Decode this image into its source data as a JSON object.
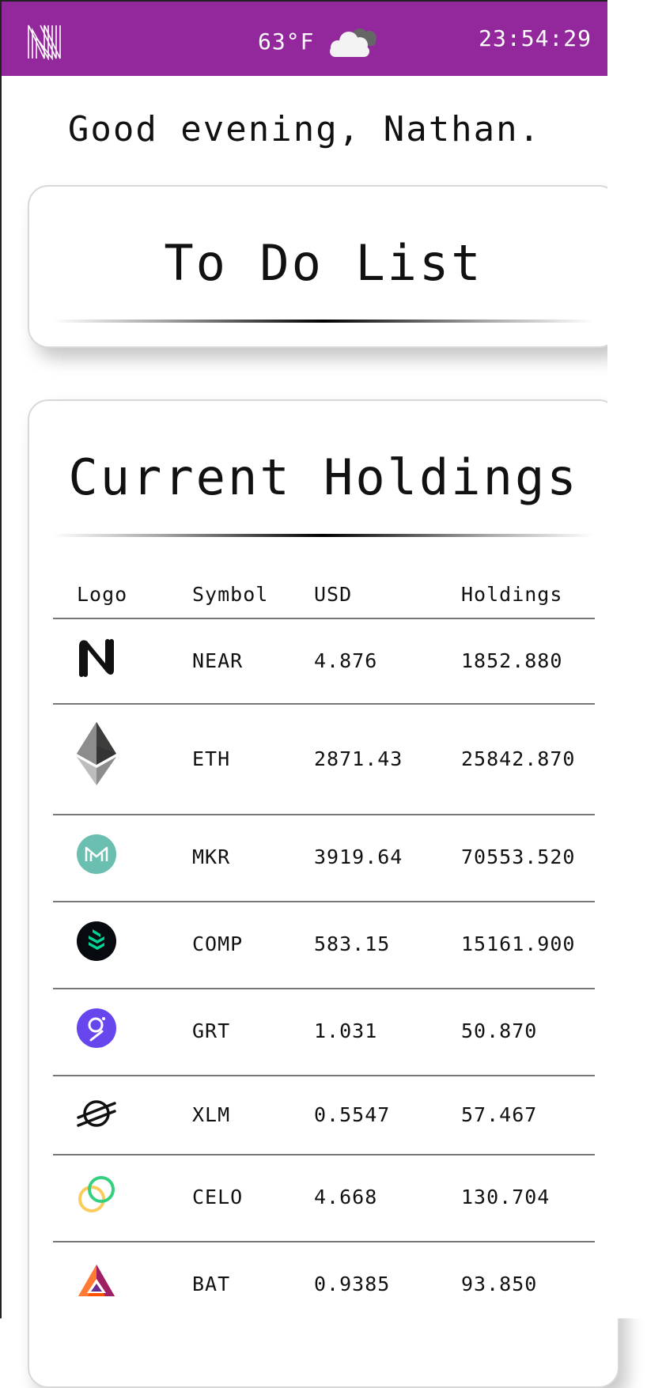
{
  "header": {
    "temperature": "63°F",
    "weather_icon": "cloud-icon",
    "time": "23:54:29",
    "bar_color": "#93289c"
  },
  "greeting": "Good evening, Nathan.",
  "todo": {
    "title": "To Do List"
  },
  "holdings": {
    "title": "Current Holdings",
    "columns": [
      "Logo",
      "Symbol",
      "USD",
      "Holdings"
    ],
    "rows": [
      {
        "logo": "near-logo-icon",
        "symbol": "NEAR",
        "usd": "4.876",
        "holdings": "1852.880"
      },
      {
        "logo": "eth-logo-icon",
        "symbol": "ETH",
        "usd": "2871.43",
        "holdings": "25842.870"
      },
      {
        "logo": "mkr-logo-icon",
        "symbol": "MKR",
        "usd": "3919.64",
        "holdings": "70553.520"
      },
      {
        "logo": "comp-logo-icon",
        "symbol": "COMP",
        "usd": "583.15",
        "holdings": "15161.900"
      },
      {
        "logo": "grt-logo-icon",
        "symbol": "GRT",
        "usd": "1.031",
        "holdings": "50.870"
      },
      {
        "logo": "xlm-logo-icon",
        "symbol": "XLM",
        "usd": "0.5547",
        "holdings": "57.467"
      },
      {
        "logo": "celo-logo-icon",
        "symbol": "CELO",
        "usd": "4.668",
        "holdings": "130.704"
      },
      {
        "logo": "bat-logo-icon",
        "symbol": "BAT",
        "usd": "0.9385",
        "holdings": "93.850"
      }
    ]
  }
}
